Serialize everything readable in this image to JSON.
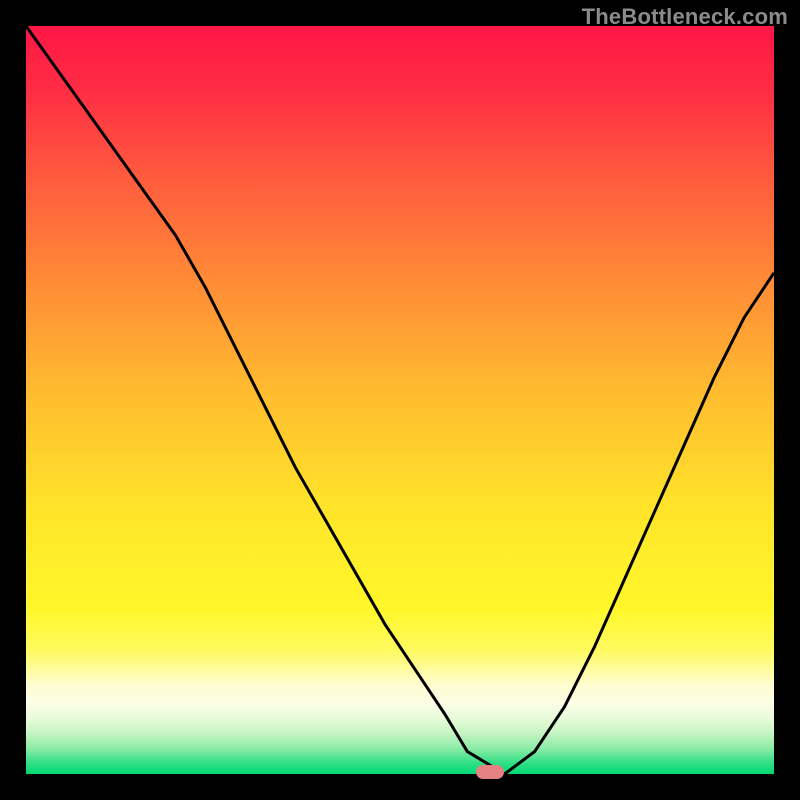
{
  "watermark": "TheBottleneck.com",
  "colors": {
    "bg": "#000000",
    "watermark": "#8b8b8b",
    "curve": "#000000",
    "marker": "#e38281",
    "gradient_stops": [
      {
        "offset": 0.0,
        "color": "#ff1745"
      },
      {
        "offset": 0.08,
        "color": "#ff2b44"
      },
      {
        "offset": 0.2,
        "color": "#ff5a3e"
      },
      {
        "offset": 0.35,
        "color": "#ff8e36"
      },
      {
        "offset": 0.5,
        "color": "#ffbf2e"
      },
      {
        "offset": 0.65,
        "color": "#ffe529"
      },
      {
        "offset": 0.78,
        "color": "#fff72a"
      },
      {
        "offset": 0.835,
        "color": "#fffb60"
      },
      {
        "offset": 0.88,
        "color": "#fffccf"
      },
      {
        "offset": 0.905,
        "color": "#fcfee6"
      },
      {
        "offset": 0.925,
        "color": "#e9fbda"
      },
      {
        "offset": 0.945,
        "color": "#c7f5c3"
      },
      {
        "offset": 0.965,
        "color": "#8eeca7"
      },
      {
        "offset": 0.985,
        "color": "#33df86"
      },
      {
        "offset": 1.0,
        "color": "#00d973"
      }
    ]
  },
  "chart_data": {
    "type": "line",
    "title": "",
    "xlabel": "",
    "ylabel": "",
    "xlim": [
      0,
      100
    ],
    "ylim": [
      0,
      100
    ],
    "grid": false,
    "legend": false,
    "marker": {
      "x": 62,
      "y": 0
    },
    "series": [
      {
        "name": "bottleneck-curve",
        "x": [
          0,
          5,
          10,
          15,
          20,
          24,
          28,
          32,
          36,
          40,
          44,
          48,
          52,
          56,
          59,
          64,
          68,
          72,
          76,
          80,
          84,
          88,
          92,
          96,
          100
        ],
        "y": [
          100,
          93,
          86,
          79,
          72,
          65,
          57,
          49,
          41,
          34,
          27,
          20,
          14,
          8,
          3,
          0,
          3,
          9,
          17,
          26,
          35,
          44,
          53,
          61,
          67
        ]
      }
    ]
  }
}
